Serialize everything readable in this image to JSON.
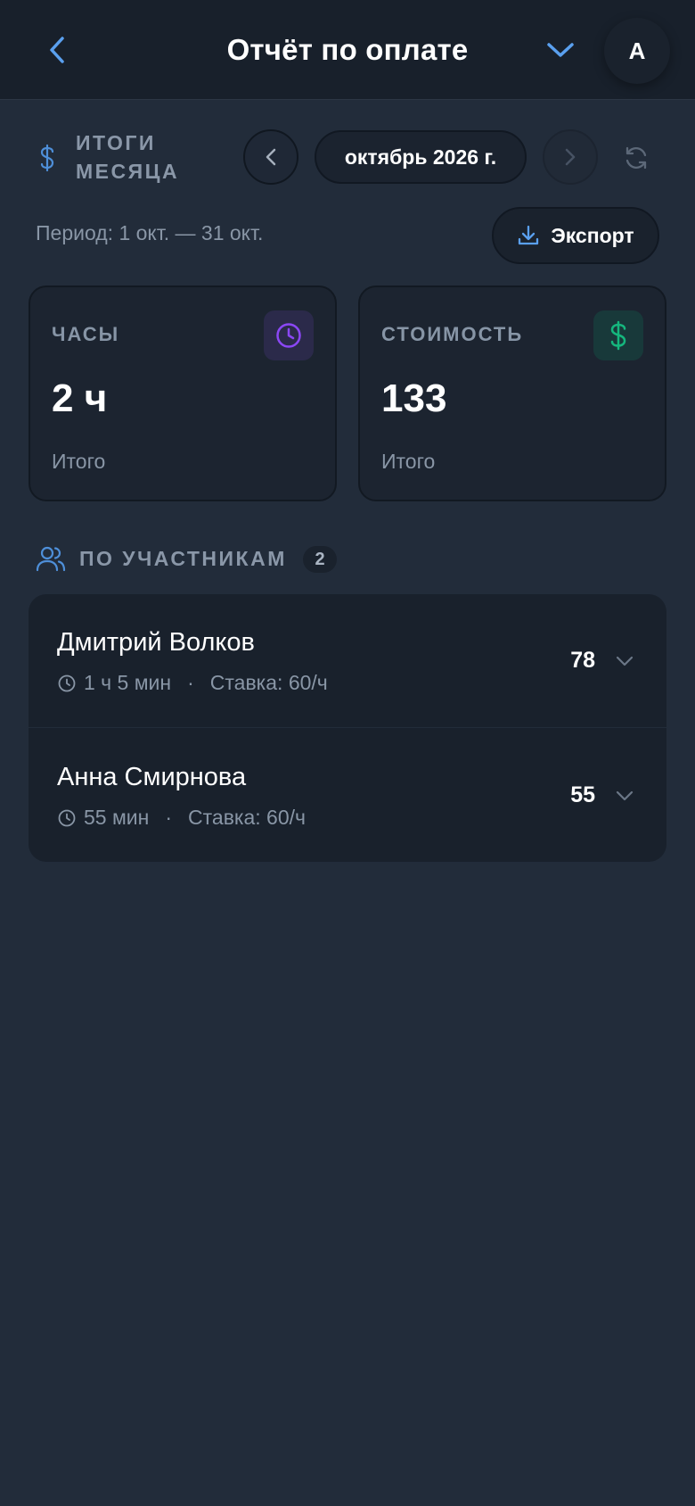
{
  "header": {
    "title": "Отчёт по оплате",
    "avatar_initial": "A"
  },
  "summary": {
    "section_title": "ИТОГИ МЕСЯЦА",
    "month_label": "октябрь 2026 г.",
    "period_text": "Период: 1 окт. — 31 окт.",
    "export_label": "Экспорт"
  },
  "cards": {
    "hours": {
      "label": "ЧАСЫ",
      "value": "2 ч",
      "sub": "Итого"
    },
    "cost": {
      "label": "СТОИМОСТЬ",
      "value": "133",
      "sub": "Итого"
    }
  },
  "participants": {
    "title": "ПО УЧАСТНИКАМ",
    "count": "2",
    "items": [
      {
        "name": "Дмитрий Волков",
        "duration": "1 ч 5 мин",
        "separator": "·",
        "rate": "Ставка: 60/ч",
        "amount": "78"
      },
      {
        "name": "Анна Смирнова",
        "duration": "55 мин",
        "separator": "·",
        "rate": "Ставка: 60/ч",
        "amount": "55"
      }
    ]
  },
  "colors": {
    "accent_blue": "#5aa0ef",
    "purple": "#8b47f5",
    "green": "#15b67d",
    "background": "#222c3a"
  }
}
